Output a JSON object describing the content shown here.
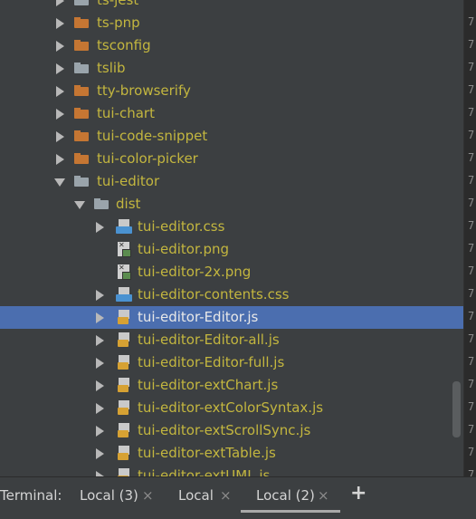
{
  "tree": {
    "rows": [
      {
        "label": "ts-jest",
        "kind": "folder",
        "color": "gray",
        "depth": 0,
        "expanded": false
      },
      {
        "label": "ts-pnp",
        "kind": "folder",
        "color": "orange",
        "depth": 0,
        "expanded": false
      },
      {
        "label": "tsconfig",
        "kind": "folder",
        "color": "orange",
        "depth": 0,
        "expanded": false
      },
      {
        "label": "tslib",
        "kind": "folder",
        "color": "gray",
        "depth": 0,
        "expanded": false
      },
      {
        "label": "tty-browserify",
        "kind": "folder",
        "color": "orange",
        "depth": 0,
        "expanded": false
      },
      {
        "label": "tui-chart",
        "kind": "folder",
        "color": "orange",
        "depth": 0,
        "expanded": false
      },
      {
        "label": "tui-code-snippet",
        "kind": "folder",
        "color": "orange",
        "depth": 0,
        "expanded": false
      },
      {
        "label": "tui-color-picker",
        "kind": "folder",
        "color": "orange",
        "depth": 0,
        "expanded": false
      },
      {
        "label": "tui-editor",
        "kind": "folder",
        "color": "gray",
        "depth": 0,
        "expanded": true
      },
      {
        "label": "dist",
        "kind": "folder",
        "color": "gray",
        "depth": 1,
        "expanded": true
      },
      {
        "label": "tui-editor.css",
        "kind": "css",
        "depth": 2,
        "expandable": true
      },
      {
        "label": "tui-editor.png",
        "kind": "img",
        "depth": 2,
        "expandable": false
      },
      {
        "label": "tui-editor-2x.png",
        "kind": "img",
        "depth": 2,
        "expandable": false
      },
      {
        "label": "tui-editor-contents.css",
        "kind": "css",
        "depth": 2,
        "expandable": true
      },
      {
        "label": "tui-editor-Editor.js",
        "kind": "js",
        "depth": 2,
        "expandable": true,
        "selected": true
      },
      {
        "label": "tui-editor-Editor-all.js",
        "kind": "js",
        "depth": 2,
        "expandable": true
      },
      {
        "label": "tui-editor-Editor-full.js",
        "kind": "js",
        "depth": 2,
        "expandable": true
      },
      {
        "label": "tui-editor-extChart.js",
        "kind": "js",
        "depth": 2,
        "expandable": true
      },
      {
        "label": "tui-editor-extColorSyntax.js",
        "kind": "js",
        "depth": 2,
        "expandable": true
      },
      {
        "label": "tui-editor-extScrollSync.js",
        "kind": "js",
        "depth": 2,
        "expandable": true
      },
      {
        "label": "tui-editor-extTable.js",
        "kind": "js",
        "depth": 2,
        "expandable": true
      },
      {
        "label": "tui-editor-extUML.js",
        "kind": "js",
        "depth": 2,
        "expandable": true
      }
    ]
  },
  "gutter": {
    "numbers": [
      "7",
      "7",
      "7",
      "7",
      "7",
      "7",
      "7",
      "7",
      "7",
      "7",
      "7",
      "7",
      "7",
      "7",
      "7",
      "7",
      "7",
      "7",
      "7",
      "7",
      "7"
    ]
  },
  "terminal": {
    "label": "Terminal:",
    "tabs": [
      {
        "label": "Local (3)",
        "active": false
      },
      {
        "label": "Local",
        "active": false
      },
      {
        "label": "Local (2)",
        "active": true
      }
    ],
    "close_glyph": "×",
    "add_glyph": "+"
  },
  "colors": {
    "background": "#3c3f41",
    "selection": "#4b6eaf",
    "label_text": "#c3b63f",
    "folder_orange": "#c57633",
    "folder_gray": "#9aa4ab"
  },
  "icons": {
    "folder": "folder-icon",
    "css": "css-file-icon",
    "js": "js-file-icon",
    "img": "image-file-icon"
  }
}
